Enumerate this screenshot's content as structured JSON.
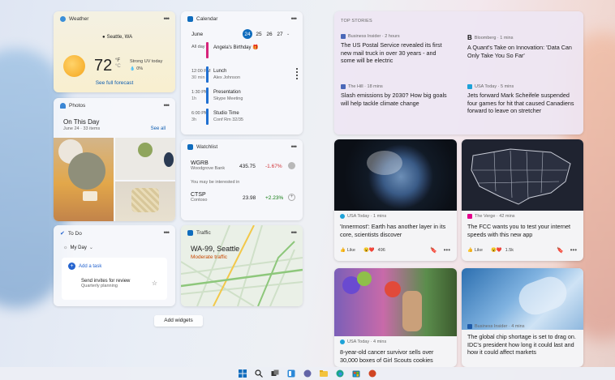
{
  "weather": {
    "title": "Weather",
    "location": "Seattle, WA",
    "temp": "72",
    "unit": "°F",
    "unit_alt": "°C",
    "condition": "Strong UV today",
    "precip": "0%",
    "link": "See full forecast"
  },
  "calendar": {
    "title": "Calendar",
    "month": "June",
    "days": [
      "24",
      "25",
      "26",
      "27"
    ],
    "events": [
      {
        "time": "All day",
        "dur": "",
        "title": "Angela's Birthday 🎁",
        "sub": "",
        "color": "#d6247b"
      },
      {
        "time": "12:00 PM",
        "dur": "30 min",
        "title": "Lunch",
        "sub": "Alex Johnson",
        "color": "#1f6fd1"
      },
      {
        "time": "1:30 PM",
        "dur": "1h",
        "title": "Presentation",
        "sub": "Skype Meeting",
        "color": "#1f6fd1"
      },
      {
        "time": "6:00 PM",
        "dur": "3h",
        "title": "Studio Time",
        "sub": "Conf Rm 32/35",
        "color": "#1f6fd1"
      }
    ]
  },
  "photos": {
    "title": "Photos",
    "heading": "On This Day",
    "date": "June 24 · 33 items",
    "see_all": "See all"
  },
  "watchlist": {
    "title": "Watchlist",
    "items": [
      {
        "sym": "WGRB",
        "name": "Woodgrove Bank",
        "price": "435.75",
        "chg": "-1.67%",
        "color": "#d13438"
      }
    ],
    "interest": "You may be interested in",
    "items2": [
      {
        "sym": "CTSP",
        "name": "Contoso",
        "price": "23.98",
        "chg": "+2.23%",
        "color": "#107c10"
      }
    ]
  },
  "todo": {
    "title": "To Do",
    "list": "My Day",
    "add": "Add a task",
    "task": "Send invites for review",
    "task_sub": "Quarterly planning"
  },
  "traffic": {
    "title": "Traffic",
    "place": "WA-99, Seattle",
    "status": "Moderate traffic"
  },
  "add_widgets": "Add widgets",
  "news": {
    "label": "TOP STORIES",
    "top": [
      {
        "source": "Business Insider · 2 hours",
        "headline": "The US Postal Service revealed its first new mail truck in over 30 years - and some will be electric",
        "icon": "#4a68b8"
      },
      {
        "source": "Bloomberg · 1 mins",
        "headline": "A Quant's Take on Innovation: 'Data Can Only Take You So Far'",
        "icon": "#111111",
        "letter": "B"
      },
      {
        "source": "The Hill · 18 mins",
        "headline": "Slash emissions by 2030? How big goals will help tackle climate change",
        "icon": "#4a68b8"
      },
      {
        "source": "USA Today · 5 mins",
        "headline": "Jets forward Mark Scheifele suspended four games for hit that caused Canadiens forward to leave on stretcher",
        "icon": "#1ea2d8"
      }
    ],
    "card1": {
      "source": "USA Today · 1 mins",
      "headline": "'Innermost': Earth has another layer in its core, scientists discover",
      "like": "Like",
      "count": "496"
    },
    "card2": {
      "source": "The Verge · 42 mins",
      "headline": "The FCC wants you to test your internet speeds with this new app",
      "like": "Like",
      "count": "1.5k"
    },
    "card3": {
      "source": "USA Today · 4 mins",
      "headline": "8-year-old cancer survivor sells over 30,000 boxes of Girl Scouts cookies"
    },
    "card4": {
      "source": "Business Insider · 4 mins",
      "headline": "The global chip shortage is set to drag on. IDC's president how long it could last and how it could affect markets"
    }
  },
  "colors": {
    "accent": "#0f6cbd",
    "warn": "#c74700"
  }
}
